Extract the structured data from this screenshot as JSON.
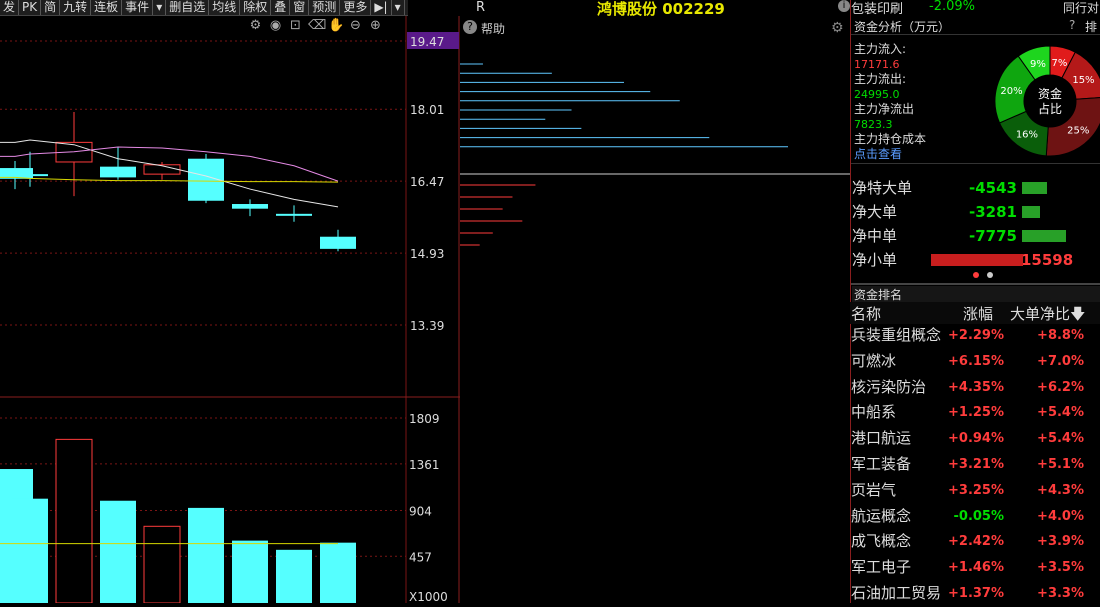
{
  "toolbar": {
    "items": [
      "发",
      "PK",
      "简",
      "九转",
      "连板",
      "事件",
      "▾",
      "删自选",
      "均线",
      "除权",
      "叠",
      "窗",
      "预测",
      "更多",
      "▶|",
      "▾"
    ]
  },
  "header": {
    "r_label": "R",
    "stock_title": "鸿博股份 002229",
    "change_pct": "-2.09%",
    "same_industry": "同行对",
    "info_mark": "i",
    "ticker_scroll": "包装印刷"
  },
  "mid": {
    "help_label": "帮助"
  },
  "price_axis": {
    "labels": [
      "19.47",
      "18.01",
      "16.47",
      "14.93",
      "13.39"
    ]
  },
  "vol_axis": {
    "labels": [
      "1809",
      "1361",
      "904",
      "457",
      "X1000"
    ]
  },
  "chart_data": [
    {
      "type": "candlestick",
      "ylim": [
        13.39,
        19.47
      ],
      "candles": [
        {
          "open": 16.75,
          "close": 16.52,
          "high": 16.9,
          "low": 16.3,
          "rising": false
        },
        {
          "open": 16.62,
          "close": 16.62,
          "high": 17.1,
          "low": 16.35,
          "rising": false
        },
        {
          "open": 16.88,
          "close": 17.3,
          "high": 17.95,
          "low": 16.15,
          "rising": true
        },
        {
          "open": 16.78,
          "close": 16.55,
          "high": 17.2,
          "low": 16.5,
          "rising": false
        },
        {
          "open": 16.62,
          "close": 16.82,
          "high": 16.88,
          "low": 16.5,
          "rising": true
        },
        {
          "open": 16.95,
          "close": 16.05,
          "high": 17.05,
          "low": 16.0,
          "rising": false
        },
        {
          "open": 15.98,
          "close": 15.88,
          "high": 16.08,
          "low": 15.72,
          "rising": false
        },
        {
          "open": 15.77,
          "close": 15.74,
          "high": 15.95,
          "low": 15.6,
          "rising": false
        },
        {
          "open": 15.28,
          "close": 15.02,
          "high": 15.43,
          "low": 14.97,
          "rising": false
        }
      ],
      "ma_white": [
        17.3,
        17.35,
        17.25,
        16.95,
        16.8,
        16.58,
        16.3,
        16.08,
        15.92
      ],
      "ma_pink": [
        17.0,
        17.05,
        17.1,
        17.2,
        17.18,
        17.1,
        17.0,
        16.8,
        16.47
      ],
      "ma_yellow": [
        16.55,
        16.53,
        16.5,
        16.48,
        16.48,
        16.47,
        16.46,
        16.46,
        16.45
      ]
    },
    {
      "type": "bar",
      "title": "volume",
      "ylim": [
        0,
        1809
      ],
      "values": [
        1310,
        1020,
        1600,
        1000,
        750,
        930,
        610,
        520,
        590
      ],
      "rising": [
        false,
        false,
        true,
        false,
        true,
        false,
        false,
        false,
        false
      ],
      "ma": 580
    }
  ],
  "depth": {
    "blue_bars": [
      0.07,
      0.28,
      0.5,
      0.58,
      0.67,
      0.34,
      0.26,
      0.37,
      0.76,
      1.0
    ],
    "red_bars": [
      0.23,
      0.16,
      0.13,
      0.19,
      0.1,
      0.06
    ]
  },
  "fund": {
    "title": "资金分析（万元）",
    "help": "?",
    "sort": "排",
    "inflow_label": "主力流入:",
    "inflow_value": "17171.6",
    "outflow_label": "主力流出:",
    "outflow_value": "24995.0",
    "net_label": "主力净流出",
    "net_value": "7823.3",
    "cost_label": "主力持仓成本",
    "view_link": "点击查看",
    "pie_center_1": "资金",
    "pie_center_2": "占比",
    "pie": [
      {
        "label": "7%",
        "v": 7,
        "color": "#e01b1b"
      },
      {
        "label": "15%",
        "v": 15,
        "color": "#b41919"
      },
      {
        "label": "25%",
        "v": 25,
        "color": "#6e1313"
      },
      {
        "label": "16%",
        "v": 16,
        "color": "#0a5e0a"
      },
      {
        "label": "20%",
        "v": 20,
        "color": "#0fa60f"
      },
      {
        "label": "9%",
        "v": 9,
        "color": "#1ed51e"
      }
    ]
  },
  "flows": [
    {
      "label": "净特大单",
      "value": "-4543",
      "n": -4543
    },
    {
      "label": "净大单",
      "value": "-3281",
      "n": -3281
    },
    {
      "label": "净中单",
      "value": "-7775",
      "n": -7775
    },
    {
      "label": "净小单",
      "value": "15598",
      "n": 15598
    }
  ],
  "ranking": {
    "title": "资金排名",
    "col_name": "名称",
    "col_change": "涨幅",
    "col_ratio": "大单净比",
    "rows": [
      {
        "name": "兵装重组概念",
        "change": "+2.29%",
        "ratio": "+8.8%"
      },
      {
        "name": "可燃冰",
        "change": "+6.15%",
        "ratio": "+7.0%"
      },
      {
        "name": "核污染防治",
        "change": "+4.35%",
        "ratio": "+6.2%"
      },
      {
        "name": "中船系",
        "change": "+1.25%",
        "ratio": "+5.4%"
      },
      {
        "name": "港口航运",
        "change": "+0.94%",
        "ratio": "+5.4%"
      },
      {
        "name": "军工装备",
        "change": "+3.21%",
        "ratio": "+5.1%"
      },
      {
        "name": "页岩气",
        "change": "+3.25%",
        "ratio": "+4.3%"
      },
      {
        "name": "航运概念",
        "change": "-0.05%",
        "ratio": "+4.0%"
      },
      {
        "name": "成飞概念",
        "change": "+2.42%",
        "ratio": "+3.9%"
      },
      {
        "name": "军工电子",
        "change": "+1.46%",
        "ratio": "+3.5%"
      },
      {
        "name": "石油加工贸易",
        "change": "+1.37%",
        "ratio": "+3.3%"
      }
    ]
  },
  "colors": {
    "rise": "#ff3c3c",
    "fall": "#55ffff",
    "ma_white": "#e6e6e6",
    "ma_pink": "#e58ae5",
    "ma_yellow": "#d8d800",
    "grid": "#7a1515"
  }
}
